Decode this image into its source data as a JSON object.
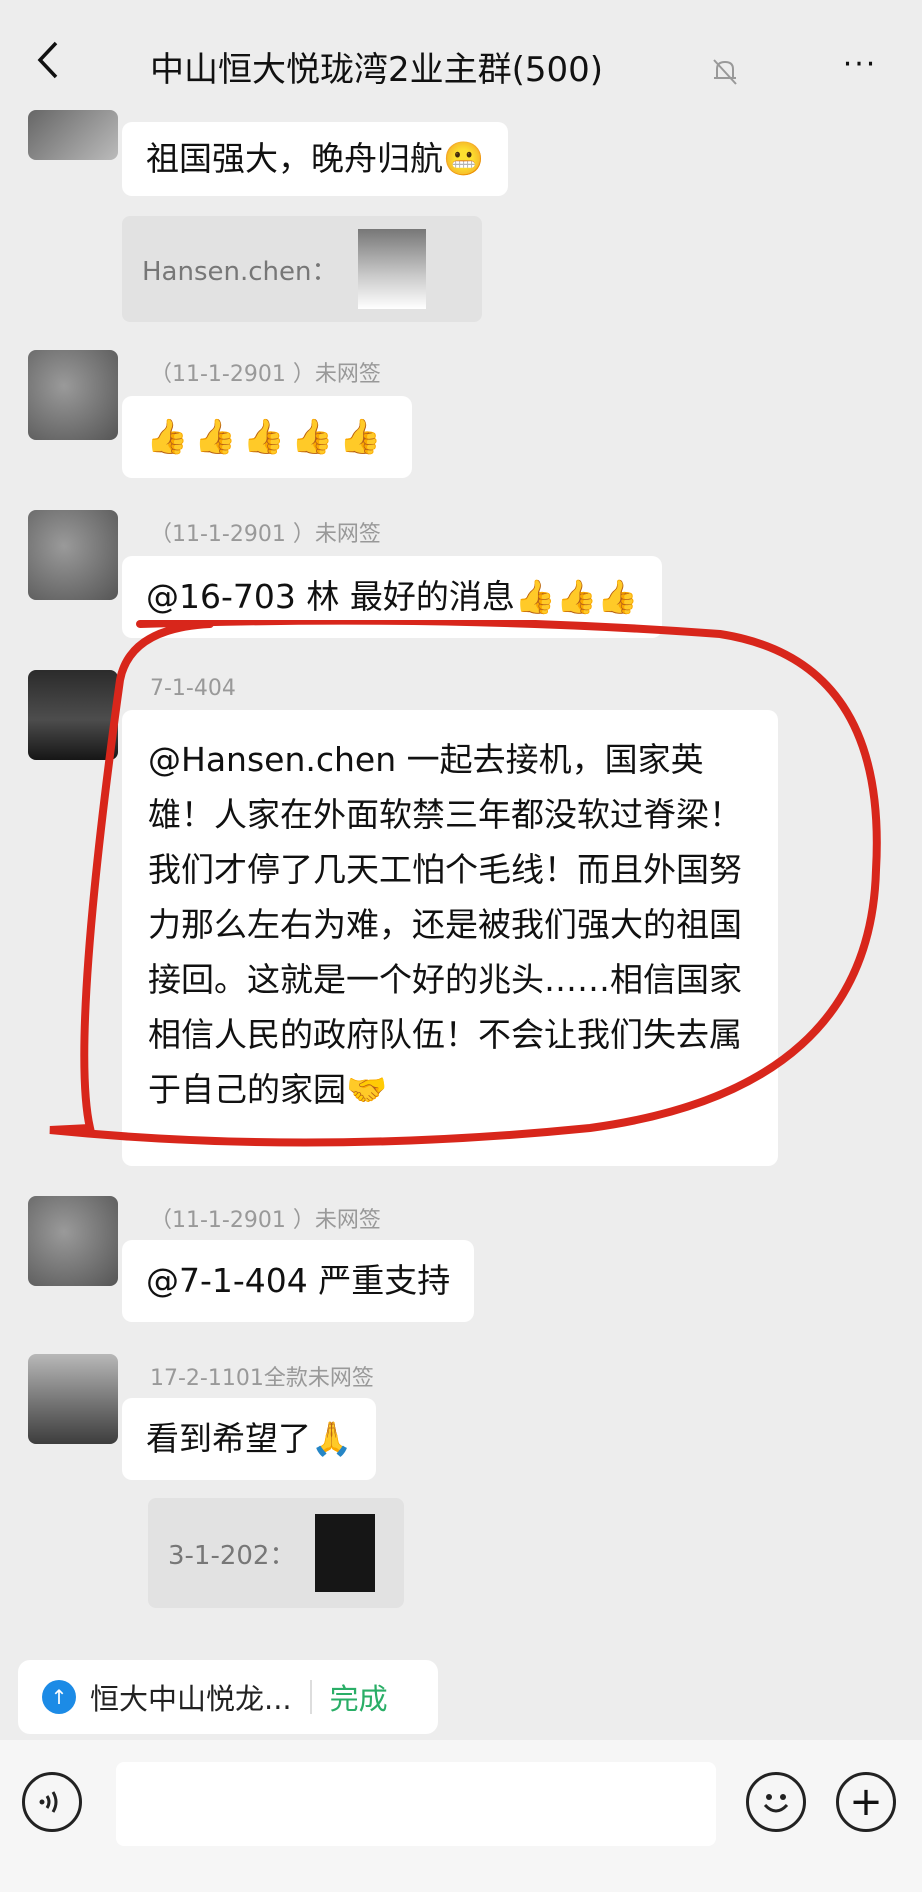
{
  "header": {
    "title": "中山恒大悦珑湾2业主群(500)",
    "more_label": "···"
  },
  "messages": [
    {
      "text": "祖国强大，晚舟归航😬",
      "quote_sender": "Hansen.chen："
    },
    {
      "nick": "（11-1-2901 ）未网签",
      "text": "👍👍👍👍👍"
    },
    {
      "nick": "（11-1-2901 ）未网签",
      "text": "@16-703 林  最好的消息👍👍👍"
    },
    {
      "nick": "7-1-404",
      "text": "@Hansen.chen 一起去接机，国家英雄！人家在外面软禁三年都没软过脊梁！我们才停了几天工怕个毛线！而且外国努力那么左右为难，还是被我们强大的祖国接回。这就是一个好的兆头……相信国家相信人民的政府队伍！不会让我们失去属于自己的家园🤝"
    },
    {
      "nick": "（11-1-2901 ）未网签",
      "text": "@7-1-404  严重支持"
    },
    {
      "nick": "17-2-1101全款未网签",
      "text": "看到希望了🙏",
      "quote_sender": "3-1-202："
    }
  ],
  "location_suggestion": {
    "place": "恒大中山悦龙...",
    "done_label": "完成"
  },
  "colors": {
    "annotation_circle": "#d8261b",
    "done_green": "#2aae67",
    "location_blue": "#1c8be6"
  }
}
